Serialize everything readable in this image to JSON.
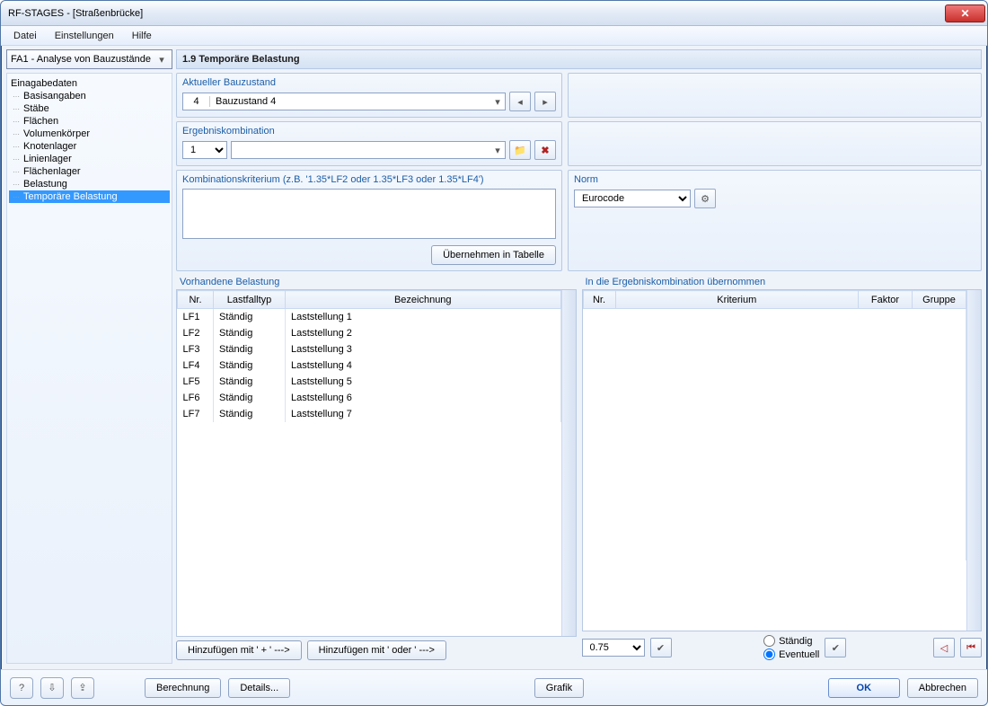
{
  "window": {
    "title": "RF-STAGES - [Straßenbrücke]"
  },
  "menu": {
    "datei": "Datei",
    "einstellungen": "Einstellungen",
    "hilfe": "Hilfe"
  },
  "left": {
    "fa_selector": "FA1 - Analyse von Bauzustände",
    "tree_root": "Einagabedaten",
    "tree": [
      "Basisangaben",
      "Stäbe",
      "Flächen",
      "Volumenkörper",
      "Knotenlager",
      "Linienlager",
      "Flächenlager",
      "Belastung",
      "Temporäre Belastung"
    ],
    "selected_index": 8
  },
  "main": {
    "header": "1.9 Temporäre Belastung",
    "aktueller_bauzustand_label": "Aktueller Bauzustand",
    "aktueller_bauzustand_num": "4",
    "aktueller_bauzustand_name": "Bauzustand 4",
    "ergebniskombination_label": "Ergebniskombination",
    "ergebniskombination_val": "1",
    "kombi_label": "Kombinationskriterium (z.B. '1.35*LF2 oder 1.35*LF3 oder 1.35*LF4')",
    "uebernehmen_btn": "Übernehmen in Tabelle",
    "norm_label": "Norm",
    "norm_value": "Eurocode",
    "vorhandene_label": "Vorhandene Belastung",
    "uebernommen_label": "In die Ergebniskombination übernommen",
    "col_nr": "Nr.",
    "col_lastfalltyp": "Lastfalltyp",
    "col_bezeichnung": "Bezeichnung",
    "col_kriterium": "Kriterium",
    "col_faktor": "Faktor",
    "col_gruppe": "Gruppe",
    "rows": [
      {
        "nr": "LF1",
        "typ": "Ständig",
        "bez": "Laststellung 1"
      },
      {
        "nr": "LF2",
        "typ": "Ständig",
        "bez": "Laststellung 2"
      },
      {
        "nr": "LF3",
        "typ": "Ständig",
        "bez": "Laststellung 3"
      },
      {
        "nr": "LF4",
        "typ": "Ständig",
        "bez": "Laststellung 4"
      },
      {
        "nr": "LF5",
        "typ": "Ständig",
        "bez": "Laststellung 5"
      },
      {
        "nr": "LF6",
        "typ": "Ständig",
        "bez": "Laststellung 6"
      },
      {
        "nr": "LF7",
        "typ": "Ständig",
        "bez": "Laststellung 7"
      }
    ],
    "hinz_plus": "Hinzufügen mit ' + ' --->",
    "hinz_oder": "Hinzufügen mit ' oder ' --->",
    "faktor_value": "0.75",
    "radio_staendig": "Ständig",
    "radio_eventuell": "Eventuell"
  },
  "footer": {
    "berechnung": "Berechnung",
    "details": "Details...",
    "grafik": "Grafik",
    "ok": "OK",
    "abbrechen": "Abbrechen"
  }
}
